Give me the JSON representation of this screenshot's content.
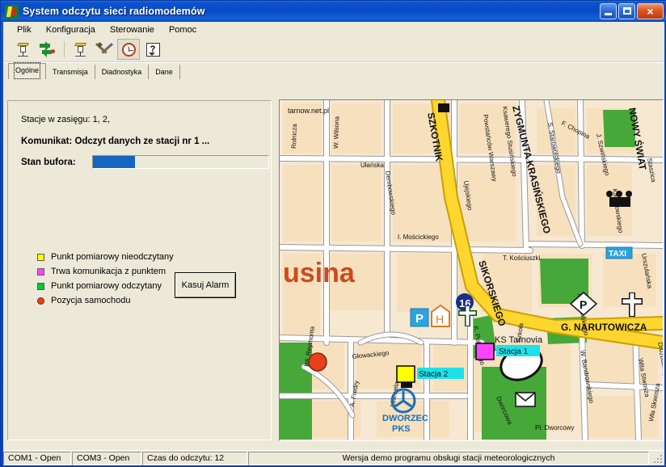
{
  "window": {
    "title": "System odczytu sieci radiomodemów",
    "icon": "radio-tower-icon",
    "buttons": {
      "minimize": "minimize-icon",
      "maximize": "maximize-icon",
      "close": "×"
    }
  },
  "menu": {
    "items": [
      "Plik",
      "Konfiguracja",
      "Sterowanie",
      "Pomoc"
    ]
  },
  "toolbar": {
    "buttons": [
      {
        "name": "read-station-icon",
        "glyph": "antenna"
      },
      {
        "name": "transmit-icon",
        "glyph": "arrows"
      },
      {
        "name": "read-all-icon",
        "glyph": "antenna"
      },
      {
        "name": "settings-icon",
        "glyph": "tools"
      },
      {
        "name": "timer-icon",
        "glyph": "clock",
        "pressed": true
      },
      {
        "name": "help-icon",
        "glyph": "help",
        "label": "?"
      }
    ]
  },
  "tabs": [
    {
      "label": "Ogólne",
      "active": true
    },
    {
      "label": "Transmisja",
      "active": false
    },
    {
      "label": "Diadnostyka",
      "active": false
    },
    {
      "label": "Dane",
      "active": false
    }
  ],
  "panel": {
    "stations_in_range": "Stacje w zasięgu: 1, 2,",
    "komunikat": "Komunikat: Odczyt danych ze stacji nr 1 ...",
    "buffer_label": "Stan bufora:",
    "buffer_percent": 24,
    "legend": [
      {
        "label": "Punkt pomiarowy nieodczytany",
        "color": "#ffff00",
        "shape": "square"
      },
      {
        "label": "Trwa komunikacja z punktem",
        "color": "#ff44ff",
        "shape": "square"
      },
      {
        "label": "Punkt pomiarowy odczytany",
        "color": "#00cc33",
        "shape": "square"
      },
      {
        "label": "Pozycja samochodu",
        "color": "#e8411a",
        "shape": "circle"
      }
    ],
    "clear_alarm_button": "Kasuj Alarm"
  },
  "map": {
    "watermark": "tarnow.net.pl",
    "city_label": "usina",
    "markers": [
      {
        "label": "Stacja 1",
        "color": "#ff44ff",
        "status": "in-communication"
      },
      {
        "label": "Stacja 2",
        "color": "#ffff00",
        "status": "not-read"
      },
      {
        "label": "car-position",
        "color": "#e8411a",
        "status": "vehicle"
      }
    ],
    "poi": [
      {
        "name": "taxi-sign",
        "label": "TAXI"
      },
      {
        "name": "parking-sign",
        "label": "P"
      },
      {
        "name": "hotel-sign",
        "label": "H"
      },
      {
        "name": "road-shield",
        "label": "16"
      },
      {
        "name": "bus-station",
        "label": "DWORZEC PKS"
      },
      {
        "name": "post-office",
        "label": "envelope"
      },
      {
        "name": "church",
        "label": "cross"
      },
      {
        "name": "stadium",
        "label": "KS Tarnovia"
      }
    ],
    "major_streets": [
      "SZKOTNIK",
      "SIKORSKIEGO",
      "ZYGMUNTA KRASIŃSKIEGO",
      "NOWY ŚWIAT",
      "G. NARUTOWICZA"
    ],
    "minor_streets": [
      "Rolnicza",
      "W. Wilsona",
      "Ułańska",
      "Dembowskiego",
      "I. Mościckiego",
      "Powstańców Warszawy",
      "Ksawerego Stusińskiego",
      "S. Starowolskiego",
      "F. Chopina",
      "J. Szwińskiego",
      "Staszica",
      "Maczewskiego",
      "Urszulańska",
      "Kaczkowskiego",
      "Szkoła",
      "Ujejskiego",
      "T. Kościuszki",
      "K. Pułaskiego",
      "Głowackiego",
      "Wł. Reymonta",
      "A. Fredry",
      "Lelewela",
      "Dworcowa",
      "Pl. Dworcowy",
      "W. Bandrowskiego",
      "Wita Stwosza",
      "Drużbackiej",
      "Wła Skwosza"
    ]
  },
  "statusbar": {
    "com1": "COM1 - Open",
    "com3": "COM3 - Open",
    "countdown": "Czas do odczytu: 12",
    "version": "Wersja demo programu obsługi stacji meteorologicznych"
  }
}
